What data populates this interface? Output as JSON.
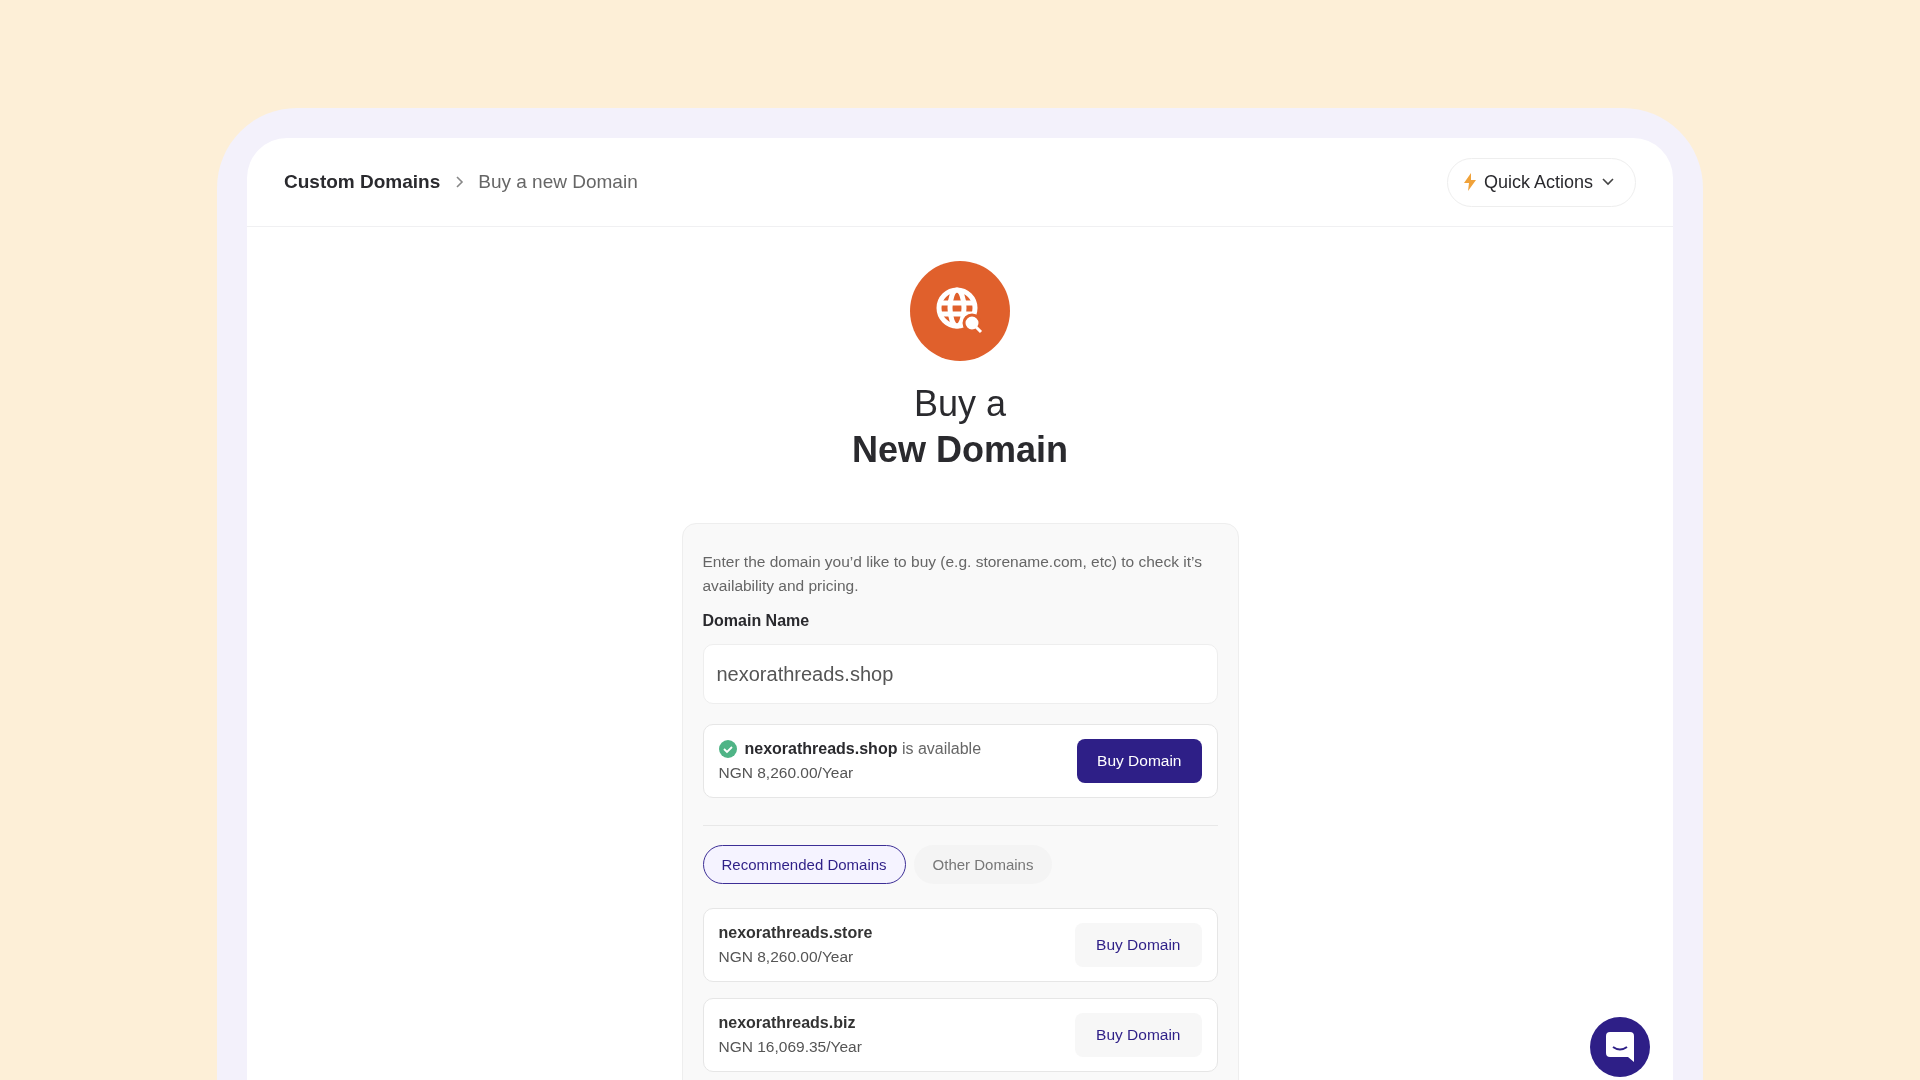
{
  "breadcrumb": {
    "parent": "Custom Domains",
    "current": "Buy a new Domain"
  },
  "quick_actions": {
    "label": "Quick Actions"
  },
  "heading": {
    "line_1": "Buy a",
    "line_2": "New Domain"
  },
  "form": {
    "intro": "Enter the domain you’d like to buy (e.g. storename.com, etc) to check it’s availability and pricing.",
    "label": "Domain Name",
    "value": "nexorathreads.shop"
  },
  "result": {
    "available": true,
    "domain": "nexorathreads.shop",
    "status": "is available",
    "price": "NGN 8,260.00/Year",
    "button": "Buy Domain"
  },
  "tabs": [
    {
      "label": "Recommended Domains",
      "selected": true
    },
    {
      "label": "Other Domains",
      "selected": false
    }
  ],
  "domains": [
    {
      "name": "nexorathreads.store",
      "price": "NGN 8,260.00/Year",
      "button": "Buy Domain"
    },
    {
      "name": "nexorathreads.biz",
      "price": "NGN 16,069.35/Year",
      "button": "Buy Domain"
    }
  ]
}
